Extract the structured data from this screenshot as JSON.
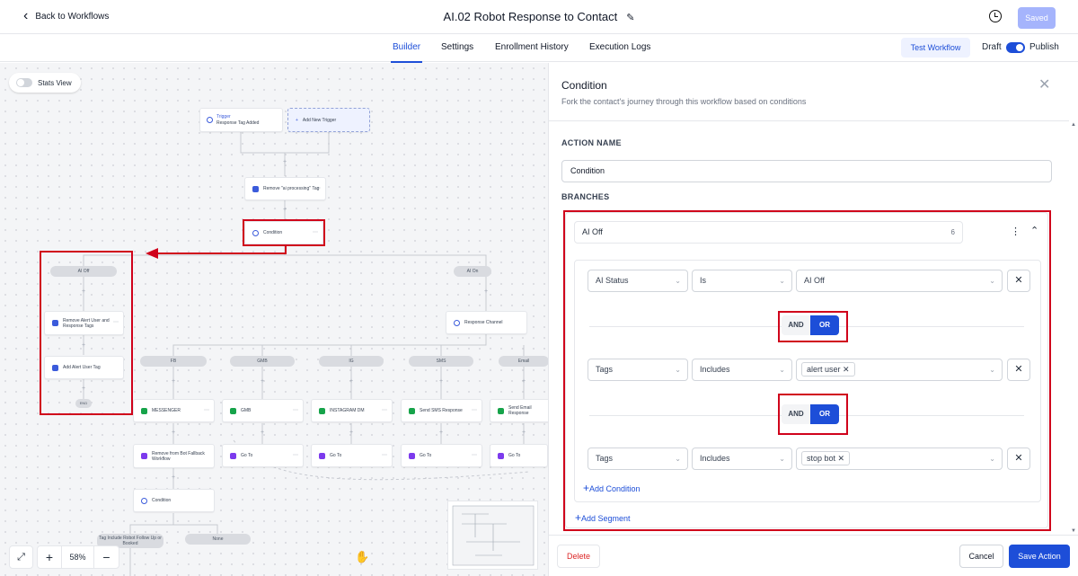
{
  "header": {
    "back_label": "Back to Workflows",
    "workflow_title": "AI.02 Robot Response to Contact",
    "saved_label": "Saved"
  },
  "tabs": [
    "Builder",
    "Settings",
    "Enrollment History",
    "Execution Logs"
  ],
  "active_tab": "Builder",
  "toolbar": {
    "test_workflow": "Test Workflow",
    "draft": "Draft",
    "publish": "Publish",
    "publish_on": true
  },
  "canvas": {
    "stats_view": "Stats View",
    "zoom": "58%",
    "nodes": {
      "trigger_title": "Trigger",
      "trigger_sub": "Response Tag Added",
      "add_trigger": "Add New Trigger",
      "remove_tag": "Remove \"ai processing\" Tag",
      "condition": "Condition",
      "ai_off": "AI Off",
      "ai_on": "AI On",
      "remove_alert": "Remove Alert User and Response Tags",
      "add_alert": "Add Alert User Tag",
      "end": "END",
      "response_channel": "Response Channel",
      "fb": "FB",
      "gmb": "GMB",
      "ig": "IG",
      "sms": "SMS",
      "email": "Email",
      "messenger": "MESSENGER",
      "gmb_action": "GMB",
      "instagram": "INSTAGRAM DM",
      "send_sms": "Send SMS Response",
      "send_email": "Send Email Response",
      "remove_bot": "Remove from Bot Fallback Workflow",
      "go_to": "Go To",
      "condition2": "Condition",
      "tag_include": "Tag Include Robot Follow Up or Booked",
      "none": "None"
    }
  },
  "panel": {
    "title": "Condition",
    "subtitle": "Fork the contact's journey through this workflow based on conditions",
    "action_name_label": "ACTION NAME",
    "action_name_value": "Condition",
    "branches_label": "BRANCHES",
    "branch": {
      "name": "AI Off",
      "count": "6",
      "conditions": [
        {
          "field": "AI Status",
          "operator": "Is",
          "value": "AI Off"
        },
        {
          "field": "Tags",
          "operator": "Includes",
          "value": "alert user"
        },
        {
          "field": "Tags",
          "operator": "Includes",
          "value": "stop bot"
        }
      ],
      "and_label": "AND",
      "or_label": "OR",
      "selected_logic": "OR",
      "add_condition": "Add Condition",
      "add_segment": "Add Segment"
    },
    "delete": "Delete",
    "cancel": "Cancel",
    "save_action": "Save Action"
  },
  "colors": {
    "primary": "#1d4ed8",
    "annotation_red": "#d0021b",
    "saved_disabled": "#a5b4fc"
  },
  "icons": [
    "chevron-left-icon",
    "pencil-icon",
    "history-icon",
    "close-icon",
    "kebab-icon",
    "chevron-up-icon",
    "chevron-down-icon",
    "plus-icon",
    "expand-icon",
    "hand-icon",
    "minus-icon"
  ]
}
